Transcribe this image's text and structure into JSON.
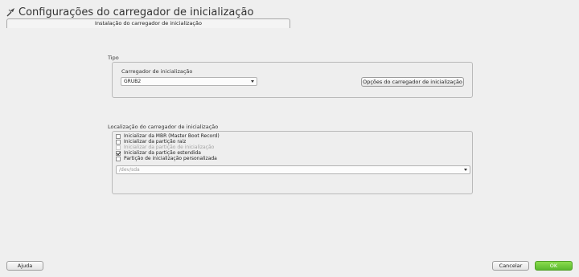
{
  "window": {
    "title": "Configurações do carregador de inicialização"
  },
  "tabs": [
    {
      "label": "Instalação do carregador de inicialização"
    }
  ],
  "tipo": {
    "group_label": "Tipo",
    "loader_label": "Carregador de inicialização",
    "loader_value": "GRUB2",
    "options_button": "Opções do carregador de inicialização"
  },
  "location": {
    "group_label": "Localização do carregador de inicialização",
    "options": [
      {
        "label": "Inicializar da MBR (Master Boot Record)",
        "checked": false,
        "enabled": true
      },
      {
        "label": "Inicializar da partição raiz",
        "checked": false,
        "enabled": true
      },
      {
        "label": "Inicializar da partição de inicialização",
        "checked": false,
        "enabled": false
      },
      {
        "label": "Inicializar da partição estendida",
        "checked": true,
        "enabled": true
      },
      {
        "label": "Partição de inicialização personalizada",
        "checked": false,
        "enabled": true
      }
    ],
    "custom_partition_placeholder": "/dev/sda"
  },
  "footer": {
    "help_button": "Ajuda",
    "cancel_button": "Cancelar",
    "ok_button": "OK"
  },
  "colors": {
    "ok_accent": "#5bb92e",
    "background": "#efefef"
  },
  "icons": {
    "title": "tools-icon",
    "dropdown": "chevron-down-icon"
  }
}
